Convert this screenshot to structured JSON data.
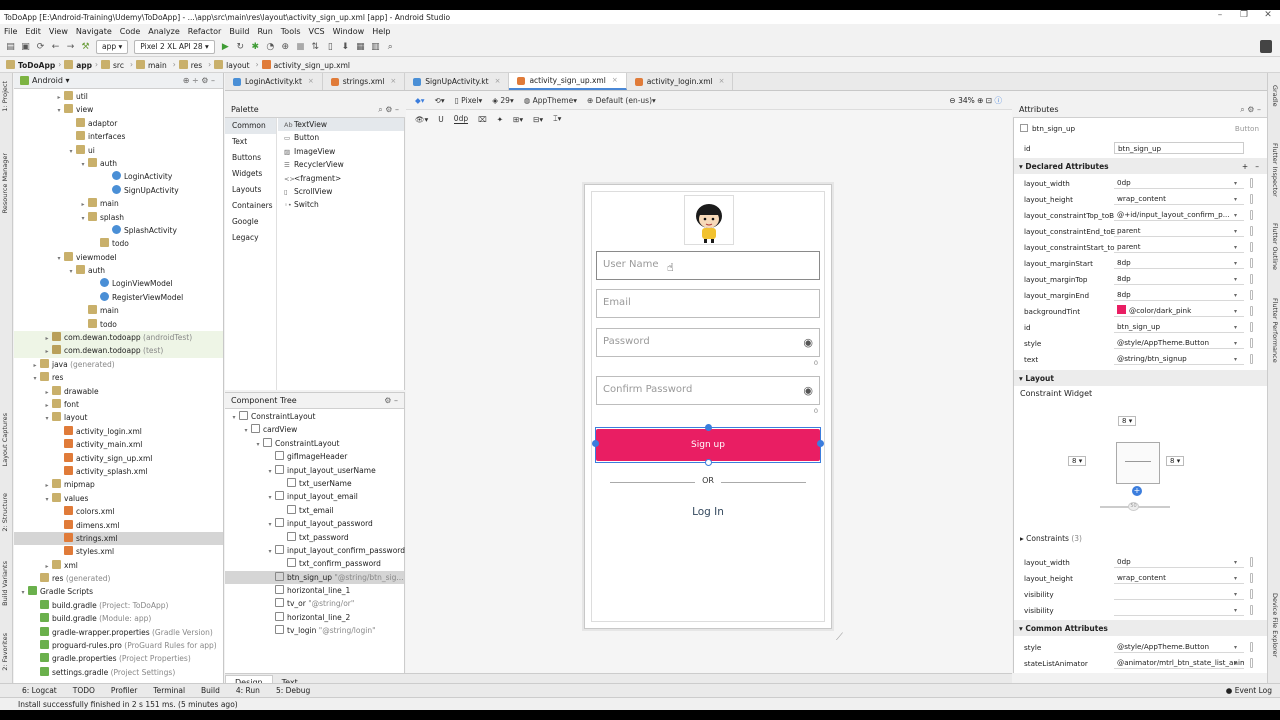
{
  "window": {
    "title": "ToDoApp [E:\\Android-Training\\Udemy\\ToDoApp] - ...\\app\\src\\main\\res\\layout\\activity_sign_up.xml [app] - Android Studio"
  },
  "menu": [
    "File",
    "Edit",
    "View",
    "Navigate",
    "Code",
    "Analyze",
    "Refactor",
    "Build",
    "Run",
    "Tools",
    "VCS",
    "Window",
    "Help"
  ],
  "toolbar": {
    "module": "app",
    "device": "Pixel 2 XL API 28"
  },
  "breadcrumbs": [
    "ToDoApp",
    "app",
    "src",
    "main",
    "res",
    "layout",
    "activity_sign_up.xml"
  ],
  "project": {
    "view": "Android",
    "rows": [
      {
        "label": "util",
        "extra": "",
        "icon": "folder",
        "indent": 3,
        "arrow": "▸",
        "state": ""
      },
      {
        "label": "view",
        "extra": "",
        "icon": "folder",
        "indent": 3,
        "arrow": "▾",
        "state": ""
      },
      {
        "label": "adaptor",
        "extra": "",
        "icon": "folder",
        "indent": 4,
        "arrow": "",
        "state": ""
      },
      {
        "label": "interfaces",
        "extra": "",
        "icon": "folder",
        "indent": 4,
        "arrow": "",
        "state": ""
      },
      {
        "label": "ui",
        "extra": "",
        "icon": "folder",
        "indent": 4,
        "arrow": "▾",
        "state": ""
      },
      {
        "label": "auth",
        "extra": "",
        "icon": "folder",
        "indent": 5,
        "arrow": "▾",
        "state": ""
      },
      {
        "label": "LoginActivity",
        "extra": "",
        "icon": "kt",
        "indent": 7,
        "arrow": "",
        "state": ""
      },
      {
        "label": "SignUpActivity",
        "extra": "",
        "icon": "kt",
        "indent": 7,
        "arrow": "",
        "state": ""
      },
      {
        "label": "main",
        "extra": "",
        "icon": "folder",
        "indent": 5,
        "arrow": "▸",
        "state": ""
      },
      {
        "label": "splash",
        "extra": "",
        "icon": "folder",
        "indent": 5,
        "arrow": "▾",
        "state": ""
      },
      {
        "label": "SplashActivity",
        "extra": "",
        "icon": "kt",
        "indent": 7,
        "arrow": "",
        "state": ""
      },
      {
        "label": "todo",
        "extra": "",
        "icon": "folder",
        "indent": 6,
        "arrow": "",
        "state": ""
      },
      {
        "label": "viewmodel",
        "extra": "",
        "icon": "folder",
        "indent": 3,
        "arrow": "▾",
        "state": ""
      },
      {
        "label": "auth",
        "extra": "",
        "icon": "folder",
        "indent": 4,
        "arrow": "▾",
        "state": ""
      },
      {
        "label": "LoginViewModel",
        "extra": "",
        "icon": "kt",
        "indent": 6,
        "arrow": "",
        "state": ""
      },
      {
        "label": "RegisterViewModel",
        "extra": "",
        "icon": "kt",
        "indent": 6,
        "arrow": "",
        "state": ""
      },
      {
        "label": "main",
        "extra": "",
        "icon": "folder",
        "indent": 5,
        "arrow": "",
        "state": ""
      },
      {
        "label": "todo",
        "extra": "",
        "icon": "folder",
        "indent": 5,
        "arrow": "",
        "state": ""
      },
      {
        "label": "com.dewan.todoapp",
        "extra": "(androidTest)",
        "icon": "pkg",
        "indent": 2,
        "arrow": "▸",
        "state": "green"
      },
      {
        "label": "com.dewan.todoapp",
        "extra": "(test)",
        "icon": "pkg",
        "indent": 2,
        "arrow": "▸",
        "state": "green"
      },
      {
        "label": "java",
        "extra": "(generated)",
        "icon": "folder",
        "indent": 1,
        "arrow": "▸",
        "state": ""
      },
      {
        "label": "res",
        "extra": "",
        "icon": "folder",
        "indent": 1,
        "arrow": "▾",
        "state": ""
      },
      {
        "label": "drawable",
        "extra": "",
        "icon": "folder",
        "indent": 2,
        "arrow": "▸",
        "state": ""
      },
      {
        "label": "font",
        "extra": "",
        "icon": "folder",
        "indent": 2,
        "arrow": "▸",
        "state": ""
      },
      {
        "label": "layout",
        "extra": "",
        "icon": "folder",
        "indent": 2,
        "arrow": "▾",
        "state": ""
      },
      {
        "label": "activity_login.xml",
        "extra": "",
        "icon": "xml",
        "indent": 3,
        "arrow": "",
        "state": ""
      },
      {
        "label": "activity_main.xml",
        "extra": "",
        "icon": "xml",
        "indent": 3,
        "arrow": "",
        "state": ""
      },
      {
        "label": "activity_sign_up.xml",
        "extra": "",
        "icon": "xml",
        "indent": 3,
        "arrow": "",
        "state": ""
      },
      {
        "label": "activity_splash.xml",
        "extra": "",
        "icon": "xml",
        "indent": 3,
        "arrow": "",
        "state": ""
      },
      {
        "label": "mipmap",
        "extra": "",
        "icon": "folder",
        "indent": 2,
        "arrow": "▸",
        "state": ""
      },
      {
        "label": "values",
        "extra": "",
        "icon": "folder",
        "indent": 2,
        "arrow": "▾",
        "state": ""
      },
      {
        "label": "colors.xml",
        "extra": "",
        "icon": "xml",
        "indent": 3,
        "arrow": "",
        "state": ""
      },
      {
        "label": "dimens.xml",
        "extra": "",
        "icon": "xml",
        "indent": 3,
        "arrow": "",
        "state": ""
      },
      {
        "label": "strings.xml",
        "extra": "",
        "icon": "xml",
        "indent": 3,
        "arrow": "",
        "state": "sel"
      },
      {
        "label": "styles.xml",
        "extra": "",
        "icon": "xml",
        "indent": 3,
        "arrow": "",
        "state": ""
      },
      {
        "label": "xml",
        "extra": "",
        "icon": "folder",
        "indent": 2,
        "arrow": "▸",
        "state": ""
      },
      {
        "label": "res",
        "extra": "(generated)",
        "icon": "folder",
        "indent": 1,
        "arrow": "",
        "state": ""
      },
      {
        "label": "Gradle Scripts",
        "extra": "",
        "icon": "gr",
        "indent": 0,
        "arrow": "▾",
        "state": ""
      },
      {
        "label": "build.gradle",
        "extra": "(Project: ToDoApp)",
        "icon": "gr",
        "indent": 1,
        "arrow": "",
        "state": ""
      },
      {
        "label": "build.gradle",
        "extra": "(Module: app)",
        "icon": "gr",
        "indent": 1,
        "arrow": "",
        "state": ""
      },
      {
        "label": "gradle-wrapper.properties",
        "extra": "(Gradle Version)",
        "icon": "gr",
        "indent": 1,
        "arrow": "",
        "state": ""
      },
      {
        "label": "proguard-rules.pro",
        "extra": "(ProGuard Rules for app)",
        "icon": "gr",
        "indent": 1,
        "arrow": "",
        "state": ""
      },
      {
        "label": "gradle.properties",
        "extra": "(Project Properties)",
        "icon": "gr",
        "indent": 1,
        "arrow": "",
        "state": ""
      },
      {
        "label": "settings.gradle",
        "extra": "(Project Settings)",
        "icon": "gr",
        "indent": 1,
        "arrow": "",
        "state": ""
      }
    ]
  },
  "editor_tabs": [
    {
      "label": "LoginActivity.kt",
      "active": false,
      "color": "#4a8fd6"
    },
    {
      "label": "strings.xml",
      "active": false,
      "color": "#e07b39"
    },
    {
      "label": "SignUpActivity.kt",
      "active": false,
      "color": "#4a8fd6"
    },
    {
      "label": "activity_sign_up.xml",
      "active": true,
      "color": "#e07b39"
    },
    {
      "label": "activity_login.xml",
      "active": false,
      "color": "#e07b39"
    }
  ],
  "palette": {
    "title": "Palette",
    "categories": [
      "Common",
      "Text",
      "Buttons",
      "Widgets",
      "Layouts",
      "Containers",
      "Google",
      "Legacy"
    ],
    "items": [
      {
        "icon": "Ab",
        "label": "TextView"
      },
      {
        "icon": "▭",
        "label": "Button"
      },
      {
        "icon": "▨",
        "label": "ImageView"
      },
      {
        "icon": "☰",
        "label": "RecyclerView"
      },
      {
        "icon": "<>",
        "label": "<fragment>"
      },
      {
        "icon": "▯",
        "label": "ScrollView"
      },
      {
        "icon": "◦•",
        "label": "Switch"
      }
    ]
  },
  "component_tree": {
    "title": "Component Tree",
    "rows": [
      {
        "label": "ConstraintLayout",
        "hint": "",
        "indent": 0
      },
      {
        "label": "cardView",
        "hint": "",
        "indent": 1
      },
      {
        "label": "ConstraintLayout",
        "hint": "",
        "indent": 2
      },
      {
        "label": "gifImageHeader",
        "hint": "",
        "indent": 3
      },
      {
        "label": "input_layout_userName",
        "hint": "",
        "indent": 3
      },
      {
        "label": "txt_userName",
        "hint": "",
        "indent": 4
      },
      {
        "label": "input_layout_email",
        "hint": "",
        "indent": 3
      },
      {
        "label": "txt_email",
        "hint": "",
        "indent": 4
      },
      {
        "label": "input_layout_password",
        "hint": "",
        "indent": 3
      },
      {
        "label": "txt_password",
        "hint": "",
        "indent": 4
      },
      {
        "label": "input_layout_confirm_password",
        "hint": "",
        "indent": 3
      },
      {
        "label": "txt_confirm_password",
        "hint": "",
        "indent": 4
      },
      {
        "label": "btn_sign_up",
        "hint": "\"@string/btn_sig...",
        "indent": 3
      },
      {
        "label": "horizontal_line_1",
        "hint": "",
        "indent": 3
      },
      {
        "label": "tv_or",
        "hint": "\"@string/or\"",
        "indent": 3
      },
      {
        "label": "horizontal_line_2",
        "hint": "",
        "indent": 3
      },
      {
        "label": "tv_login",
        "hint": "\"@string/login\"",
        "indent": 3
      }
    ]
  },
  "design_toolbar": {
    "device": "Pixel",
    "api": "29",
    "theme": "AppTheme",
    "locale": "Default (en-us)",
    "zoom": "34%",
    "margin": "0dp"
  },
  "phone": {
    "username_hint": "User Name",
    "email_hint": "Email",
    "password_hint": "Password",
    "confirm_hint": "Confirm Password",
    "counter": "0",
    "signup_label": "Sign up",
    "or_label": "OR",
    "login_label": "Log In",
    "accent": "#e91e63"
  },
  "attributes": {
    "title": "Attributes",
    "component": "btn_sign_up",
    "component_type": "Button",
    "id_label": "id",
    "id_value": "btn_sign_up",
    "declared_title": "Declared Attributes",
    "declared": [
      {
        "name": "layout_width",
        "value": "0dp"
      },
      {
        "name": "layout_height",
        "value": "wrap_content"
      },
      {
        "name": "layout_constraintTop_toB",
        "value": "@+id/input_layout_confirm_p..."
      },
      {
        "name": "layout_constraintEnd_toE",
        "value": "parent"
      },
      {
        "name": "layout_constraintStart_to",
        "value": "parent"
      },
      {
        "name": "layout_marginStart",
        "value": "8dp"
      },
      {
        "name": "layout_marginTop",
        "value": "8dp"
      },
      {
        "name": "layout_marginEnd",
        "value": "8dp"
      },
      {
        "name": "backgroundTint",
        "value": "@color/dark_pink"
      },
      {
        "name": "id",
        "value": "btn_sign_up"
      },
      {
        "name": "style",
        "value": "@style/AppTheme.Button"
      },
      {
        "name": "text",
        "value": "@string/btn_signup"
      }
    ],
    "layout_title": "Layout",
    "constraint_widget": "Constraint Widget",
    "margin_top": "8",
    "margin_start": "8",
    "margin_end": "8",
    "bias": "50",
    "constraints_label": "Constraints",
    "constraints_count": "(3)",
    "layout_rows": [
      {
        "name": "layout_width",
        "value": "0dp"
      },
      {
        "name": "layout_height",
        "value": "wrap_content"
      },
      {
        "name": "visibility",
        "value": ""
      },
      {
        "name": "visibility",
        "value": ""
      }
    ],
    "common_title": "Common Attributes",
    "common": [
      {
        "name": "style",
        "value": "@style/AppTheme.Button"
      },
      {
        "name": "stateListAnimator",
        "value": "@animator/mtrl_btn_state_list_anim"
      }
    ]
  },
  "design_tabs": [
    "Design",
    "Text"
  ],
  "tool_windows": [
    "6: Logcat",
    "TODO",
    "Profiler",
    "Terminal",
    "Build",
    "4: Run",
    "5: Debug"
  ],
  "event_log": "Event Log",
  "status": "Install successfully finished in 2 s 151 ms. (5 minutes ago)",
  "left_strip": [
    "1: Project",
    "Resource Manager",
    "Layout Captures",
    "2: Structure",
    "Build Variants",
    "2: Favorites"
  ],
  "right_strip": [
    "Gradle",
    "Flutter Inspector",
    "Flutter Outline",
    "Flutter Performance",
    "Device File Explorer"
  ]
}
